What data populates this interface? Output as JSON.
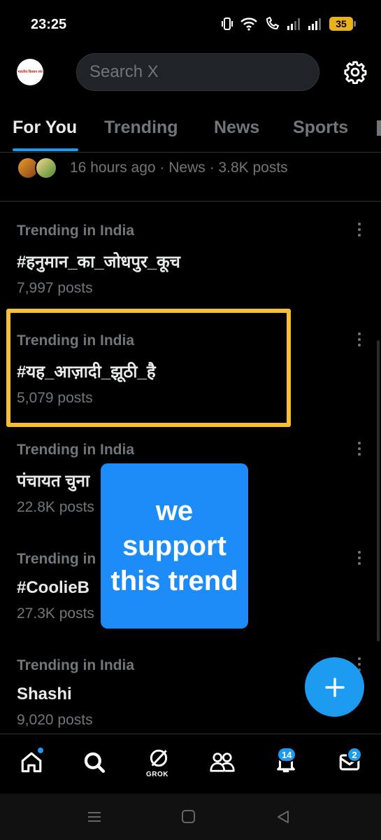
{
  "status_bar": {
    "time": "23:25",
    "battery": "35"
  },
  "header": {
    "avatar_logo_text": "भारतीय किसान संघ",
    "search_placeholder": "Search X"
  },
  "tabs": [
    {
      "label": "For You",
      "active": true
    },
    {
      "label": "Trending",
      "active": false
    },
    {
      "label": "News",
      "active": false
    },
    {
      "label": "Sports",
      "active": false
    }
  ],
  "news_row": {
    "meta": "16 hours ago · News · 3.8K posts"
  },
  "trends": [
    {
      "context": "Trending in India",
      "name": "#हनुमान_का_जोधपुर_कूच",
      "count": "7,997 posts"
    },
    {
      "context": "Trending in India",
      "name": "#यह_आज़ादी_झूठी_है",
      "count": "5,079 posts"
    },
    {
      "context": "Trending in India",
      "name": "पंचायत चुना",
      "count": "22.8K posts"
    },
    {
      "context": "Trending in",
      "name": "#CoolieB",
      "count": "27.3K posts"
    },
    {
      "context": "Trending in India",
      "name": "Shashi",
      "count": "9,020 posts"
    }
  ],
  "overlay": {
    "text": "we support this trend"
  },
  "bottom_nav": {
    "grok_label": "GROK",
    "notifications_badge": "14",
    "messages_badge": "2"
  },
  "colors": {
    "accent": "#1d9bf0",
    "highlight": "#f5c12e",
    "overlay": "#1d8cf8"
  }
}
